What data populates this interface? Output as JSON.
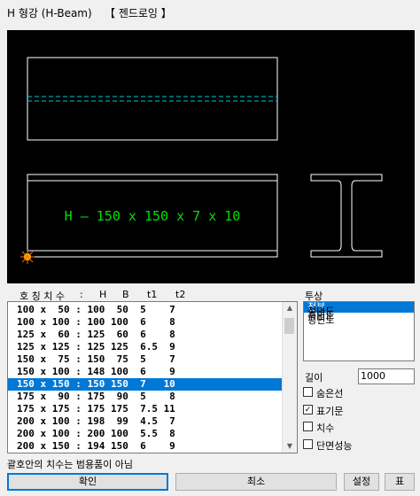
{
  "window": {
    "title": "H 형강 (H-Beam)",
    "subtitle": "【 젠드로잉 】"
  },
  "viewport": {
    "label": "H – 150 x 150 x 7 x 10"
  },
  "list": {
    "headers": [
      "호 칭 치 수",
      ":",
      "H",
      "B",
      "t1",
      "t2"
    ],
    "rows": [
      "100 x  50 : 100  50  5    7",
      "100 x 100 : 100 100  6    8",
      "125 x  60 : 125  60  6    8",
      "125 x 125 : 125 125  6.5  9",
      "150 x  75 : 150  75  5    7",
      "150 x 100 : 148 100  6    9",
      "150 x 150 : 150 150  7   10",
      "175 x  90 : 175  90  5    8",
      "175 x 175 : 175 175  7.5 11",
      "200 x 100 : 198  99  4.5  7",
      "200 x 100 : 200 100  5.5  8",
      "200 x 150 : 194 150  6    9"
    ],
    "selected_index": 6
  },
  "projection": {
    "label": "투상",
    "items": [
      "전부",
      "정면도",
      "측면도",
      "평면도"
    ],
    "selected_index": 0
  },
  "length": {
    "label": "길이",
    "value": "1000"
  },
  "options": [
    {
      "label": "숨은선",
      "checked": false
    },
    {
      "label": "표기문",
      "checked": true
    },
    {
      "label": "치수",
      "checked": false
    },
    {
      "label": "단면성능",
      "checked": false
    }
  ],
  "note": "괄호안의 치수는 범용품이 아님",
  "buttons": {
    "ok": "확인",
    "cancel": "최소",
    "settings": "설정",
    "table": "표"
  },
  "colors": {
    "label_green": "#00e000",
    "centerline_cyan": "#00c8c8",
    "selection": "#0078d7"
  }
}
